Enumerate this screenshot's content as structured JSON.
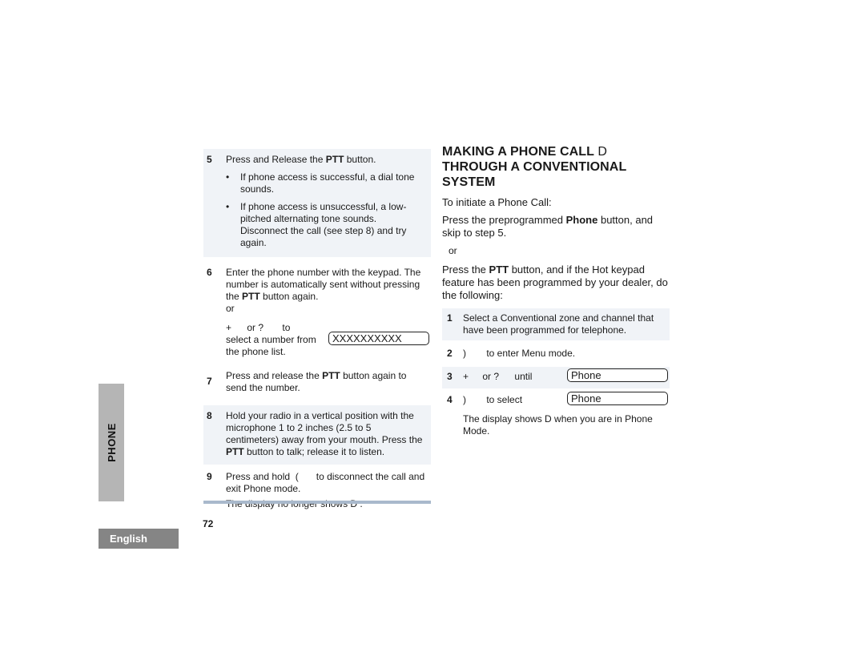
{
  "side_tab": {
    "section": "PHONE",
    "language": "English"
  },
  "page_number": "72",
  "left_column": {
    "steps": [
      {
        "num": "5",
        "text_pre": "Press and Release the ",
        "bold": "PTT",
        "text_post": " button.",
        "bullets": [
          "If phone access is successful, a dial tone sounds.",
          "If phone access is unsuccessful, a low-pitched alternating tone sounds. Disconnect the call (see step 8) and try again."
        ]
      },
      {
        "num": "6",
        "line1": "Enter the phone number with the keypad. The number is automatically sent without pressing the ",
        "bold": "PTT",
        "line1_post": " button again.",
        "or": "or",
        "alt_key1": "+",
        "alt_or": "or",
        "alt_key2": "?",
        "alt_to": "to",
        "alt_text": "select a number from the phone list.",
        "display": "XXXXXXXXXX"
      },
      {
        "num": "7",
        "text_pre": "Press and release the ",
        "bold": "PTT",
        "text_post": " button again to send the number."
      },
      {
        "num": "8",
        "text_pre": "Hold your radio in a vertical position with the microphone 1 to 2 inches (2.5 to 5 centimeters) away from your mouth. Press the ",
        "bold": "PTT",
        "text_post": " button to talk; release it to listen."
      },
      {
        "num": "9",
        "text_pre": "Press and hold",
        "key": "(",
        "text_post": "to disconnect the call and exit Phone mode.",
        "note": "The display no longer shows D ."
      }
    ]
  },
  "right_column": {
    "heading_line1": "MAKING A PHONE CALL",
    "heading_symbol": "D",
    "heading_line2": "THROUGH A CONVENTIONAL SYSTEM",
    "intro": "To initiate a Phone Call:",
    "option1_pre": "Press the preprogrammed ",
    "option1_bold": "Phone",
    "option1_post": " button, and skip to step 5.",
    "or": "or",
    "option2_pre": "Press the ",
    "option2_bold": "PTT",
    "option2_post": " button, and if the Hot keypad feature has been programmed by your dealer, do the following:",
    "steps": [
      {
        "num": "1",
        "text": "Select a Conventional zone and channel that have been programmed for telephone."
      },
      {
        "num": "2",
        "key": ")",
        "text": "to enter Menu mode."
      },
      {
        "num": "3",
        "key": "+",
        "or": "or ?",
        "text": "until",
        "display": "Phone"
      },
      {
        "num": "4",
        "key": ")",
        "text": "to select",
        "display": "Phone",
        "note": "The display shows D  when you are in Phone Mode."
      }
    ]
  }
}
